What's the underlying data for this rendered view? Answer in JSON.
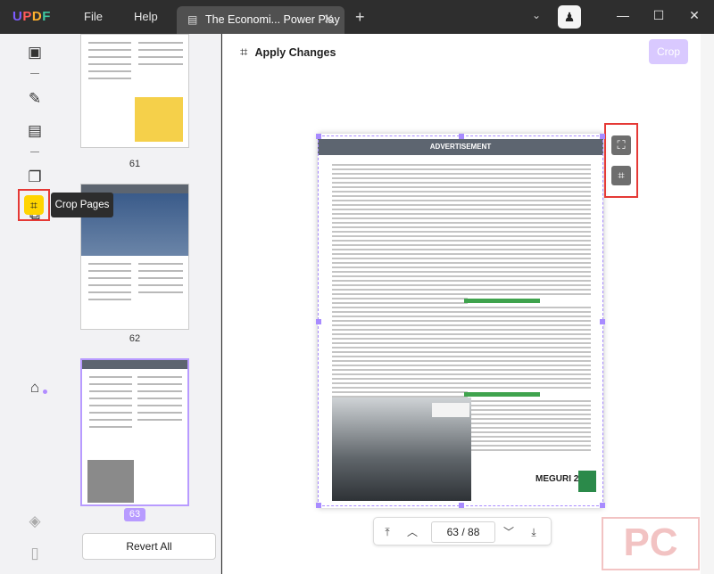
{
  "app": {
    "logo": "UPDF"
  },
  "menu": {
    "file": "File",
    "help": "Help"
  },
  "tab": {
    "title": "The Economi... Power Play",
    "close_icon": "close-icon"
  },
  "toolbar": {
    "apply_label": "Apply Changes",
    "crop_label": "Crop"
  },
  "sidebar": {
    "tooltip": "Crop Pages"
  },
  "thumbnails": [
    {
      "page": "61"
    },
    {
      "page": "62"
    },
    {
      "page": "63"
    }
  ],
  "revert_label": "Revert All",
  "page_content": {
    "header": "ADVERTISEMENT",
    "logo_text": "MEGURI 2040"
  },
  "navigation": {
    "current": "63",
    "total": "88",
    "separator": "/"
  },
  "watermark": "PC",
  "colors": {
    "accent": "#b89bff",
    "highlight": "#e53935",
    "tool_active": "#ffd400"
  }
}
